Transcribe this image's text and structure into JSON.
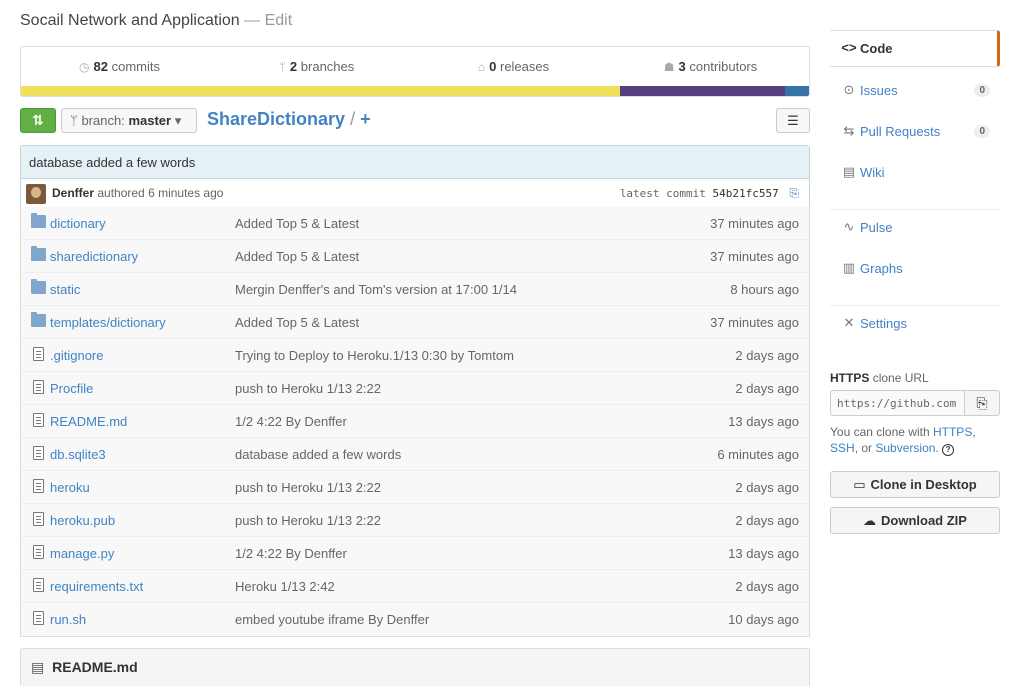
{
  "repo": {
    "title": "Socail Network and Application",
    "edit": "— Edit"
  },
  "stats": [
    {
      "icon": "history-icon",
      "count": "82",
      "label": "commits"
    },
    {
      "icon": "branch-icon",
      "count": "2",
      "label": "branches"
    },
    {
      "icon": "tag-icon",
      "count": "0",
      "label": "releases"
    },
    {
      "icon": "organization-icon",
      "count": "3",
      "label": "contributors"
    }
  ],
  "languages": [
    {
      "color": "#f1e05a",
      "share": 0.76
    },
    {
      "color": "#563d7c",
      "share": 0.21
    },
    {
      "color": "#3572a5",
      "share": 0.03
    }
  ],
  "file_nav": {
    "branch_prefix": "branch:",
    "branch": "master",
    "repo_name": "ShareDictionary",
    "sep": "/",
    "add": "+"
  },
  "commit": {
    "message": "database added a few words",
    "author": "Denffer",
    "authored": "authored 6 minutes ago",
    "latest_label": "latest commit",
    "sha": "54b21fc557"
  },
  "files": [
    {
      "type": "dir",
      "name": "dictionary",
      "message": "Added Top 5 & Latest",
      "age": "37 minutes ago"
    },
    {
      "type": "dir",
      "name": "sharedictionary",
      "message": "Added Top 5 & Latest",
      "age": "37 minutes ago"
    },
    {
      "type": "dir",
      "name": "static",
      "message": "Mergin Denffer's and Tom's version at 17:00 1/14",
      "age": "8 hours ago"
    },
    {
      "type": "dir",
      "name": "templates/dictionary",
      "message": "Added Top 5 & Latest",
      "age": "37 minutes ago"
    },
    {
      "type": "file",
      "name": ".gitignore",
      "message": "Trying to Deploy to Heroku.1/13 0:30 by Tomtom",
      "age": "2 days ago"
    },
    {
      "type": "file",
      "name": "Procfile",
      "message": "push to Heroku 1/13 2:22",
      "age": "2 days ago"
    },
    {
      "type": "file",
      "name": "README.md",
      "message": "1/2 4:22 By Denffer",
      "age": "13 days ago"
    },
    {
      "type": "file",
      "name": "db.sqlite3",
      "message": "database added a few words",
      "age": "6 minutes ago"
    },
    {
      "type": "file",
      "name": "heroku",
      "message": "push to Heroku 1/13 2:22",
      "age": "2 days ago"
    },
    {
      "type": "file",
      "name": "heroku.pub",
      "message": "push to Heroku 1/13 2:22",
      "age": "2 days ago"
    },
    {
      "type": "file",
      "name": "manage.py",
      "message": "1/2 4:22 By Denffer",
      "age": "13 days ago"
    },
    {
      "type": "file",
      "name": "requirements.txt",
      "message": "Heroku 1/13 2:42",
      "age": "2 days ago"
    },
    {
      "type": "file",
      "name": "run.sh",
      "message": "embed youtube iframe By Denffer",
      "age": "10 days ago"
    }
  ],
  "readme": {
    "title": "README.md"
  },
  "sidebar": {
    "code": "Code",
    "issues": "Issues",
    "issues_count": "0",
    "pulls": "Pull Requests",
    "pulls_count": "0",
    "wiki": "Wiki",
    "pulse": "Pulse",
    "graphs": "Graphs",
    "settings": "Settings"
  },
  "clone": {
    "protocol": "HTTPS",
    "label": "clone URL",
    "url": "https://github.com",
    "help_prefix": "You can clone with",
    "https": "HTTPS",
    "ssh": "SSH",
    "or": ", or",
    "subversion": "Subversion",
    "desktop_button": "Clone in Desktop",
    "zip_button": "Download ZIP"
  }
}
